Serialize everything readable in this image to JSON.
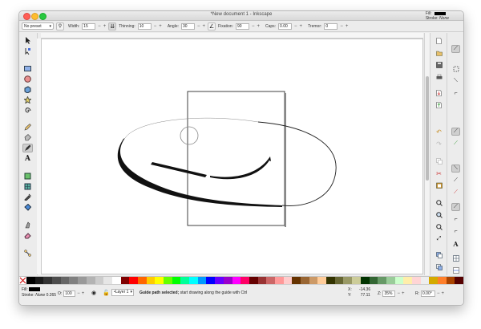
{
  "window": {
    "title": "*New document 1 - Inkscape",
    "fill_label": "Fill:",
    "stroke_label": "Stroke:",
    "stroke_value": "None"
  },
  "controls": {
    "preset": "No preset",
    "width_label": "Width:",
    "width_value": "15",
    "thinning_label": "Thinning:",
    "thinning_value": "10",
    "angle_label": "Angle:",
    "angle_value": "30",
    "fixation_label": "Fixation:",
    "fixation_value": "90",
    "caps_label": "Caps:",
    "caps_value": "0.00",
    "tremor_label": "Tremor:",
    "tremor_value": "0",
    "minus": "−",
    "plus": "+"
  },
  "palette": {
    "colors": [
      "#000000",
      "#1a1a1a",
      "#333333",
      "#4d4d4d",
      "#666666",
      "#808080",
      "#999999",
      "#b3b3b3",
      "#cccccc",
      "#e6e6e6",
      "#ffffff",
      "#800000",
      "#ff0000",
      "#ff6600",
      "#ffcc00",
      "#ffff00",
      "#66ff00",
      "#00ff00",
      "#00ff99",
      "#00ffff",
      "#0099ff",
      "#0000ff",
      "#6600ff",
      "#9900cc",
      "#ff00ff",
      "#ff0066",
      "#660000",
      "#993333",
      "#cc6666",
      "#ff9999",
      "#ffcccc",
      "#663300",
      "#996633",
      "#cc9966",
      "#ffcc99",
      "#333300",
      "#666633",
      "#999966",
      "#cccc99",
      "#003300",
      "#336633",
      "#669966",
      "#99cc99",
      "#ccffcc",
      "#ffeeaa",
      "#ffd5d5",
      "#eeeeee",
      "#d4aa00",
      "#ff7f2a",
      "#aa4400",
      "#550000"
    ]
  },
  "status": {
    "fill_label": "Fill:",
    "stroke_label": "Stroke:",
    "stroke_value": "None",
    "stroke_width": "0.265",
    "opacity_label": "O:",
    "opacity_value": "100",
    "layer": "•Layer 1",
    "message_bold": "Guide path selected;",
    "message_rest": " start drawing along the guide with Ctrl",
    "x_label": "X:",
    "x_value": "-14.36",
    "y_label": "Y:",
    "y_value": "77.11",
    "z_label": "Z:",
    "zoom_value": "35%",
    "r_label": "R:",
    "rotation_value": "0.00°"
  }
}
